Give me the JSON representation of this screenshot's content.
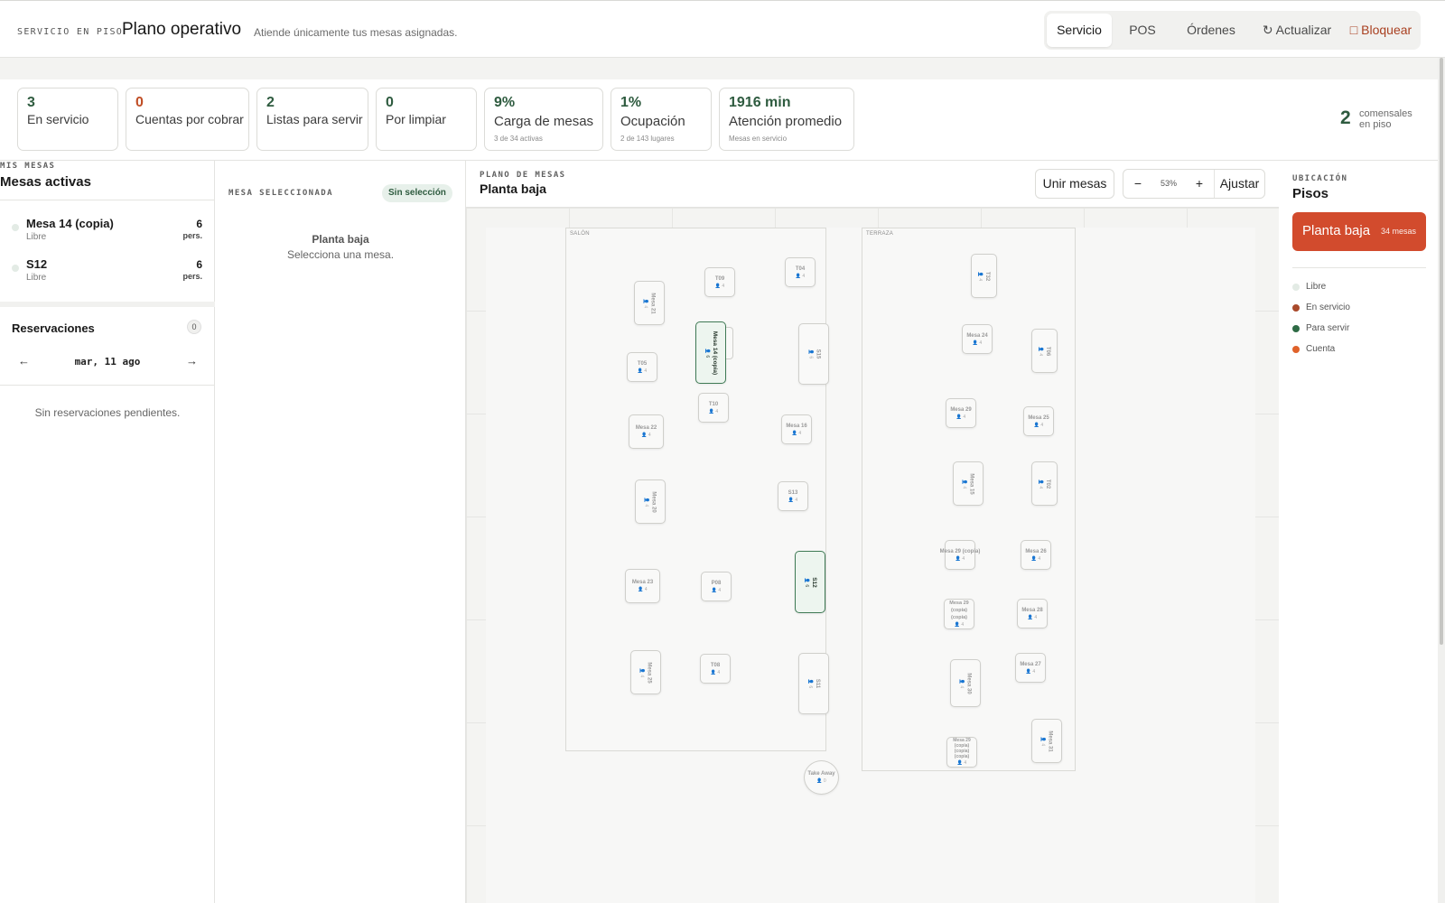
{
  "header": {
    "eyebrow": "SERVICIO EN PISO",
    "title": "Plano operativo",
    "subtitle": "Atiende únicamente tus mesas asignadas.",
    "nav": {
      "servicio": "Servicio",
      "pos": "POS",
      "ordenes": "Órdenes",
      "actualizar": "↻ Actualizar",
      "bloquear": "□ Bloquear"
    }
  },
  "stats": {
    "en_servicio": {
      "value": "3",
      "label": "En servicio"
    },
    "cuentas": {
      "value": "0",
      "label": "Cuentas por cobrar"
    },
    "listas": {
      "value": "2",
      "label": "Listas para servir"
    },
    "limpiar": {
      "value": "0",
      "label": "Por limpiar"
    },
    "carga": {
      "value": "9%",
      "label": "Carga de mesas",
      "note": "3 de 34 activas"
    },
    "ocupacion": {
      "value": "1%",
      "label": "Ocupación",
      "note": "2 de 143 lugares"
    },
    "atencion": {
      "value": "1916 min",
      "label": "Atención promedio",
      "note": "Mesas en servicio"
    },
    "comensales": {
      "value": "2",
      "label": "comensales en piso"
    }
  },
  "mis_mesas": {
    "eyebrow": "MIS MESAS",
    "title": "Mesas activas",
    "items": [
      {
        "name": "Mesa 14 (copia)",
        "status": "Libre",
        "capacity": "6",
        "unit": "pers."
      },
      {
        "name": "S12",
        "status": "Libre",
        "capacity": "6",
        "unit": "pers."
      }
    ]
  },
  "reservaciones": {
    "title": "Reservaciones",
    "count": "0",
    "prev": "←",
    "next": "→",
    "date": "mar, 11 ago",
    "empty": "Sin reservaciones pendientes."
  },
  "seleccion": {
    "eyebrow": "MESA SELECCIONADA",
    "badge": "Sin selección",
    "floor": "Planta baja",
    "message": "Selecciona una mesa."
  },
  "plano": {
    "eyebrow": "PLANO DE MESAS",
    "title": "Planta baja",
    "unir": "Unir mesas",
    "zoom_out": "−",
    "zoom_level": "53%",
    "zoom_in": "+",
    "ajustar": "Ajustar",
    "zones": {
      "salon": "SALÓN",
      "terraza": "TERRAZA"
    },
    "tables": {
      "mesa21": {
        "name": "Mesa 21",
        "cap": "4"
      },
      "t09": {
        "name": "T09",
        "cap": "4"
      },
      "t04": {
        "name": "T04",
        "cap": "4"
      },
      "t32": {
        "name": "T32",
        "cap": "4"
      },
      "mesa14": {
        "name": "Mesa 14 (copia)",
        "cap": "6"
      },
      "s15": {
        "name": "S15",
        "cap": "6"
      },
      "mesa24": {
        "name": "Mesa 24",
        "cap": "4"
      },
      "t06": {
        "name": "T06",
        "cap": "4"
      },
      "t05": {
        "name": "T05",
        "cap": "4"
      },
      "t10": {
        "name": "T10",
        "cap": "4"
      },
      "mesa22": {
        "name": "Mesa 22",
        "cap": "4"
      },
      "mesa16": {
        "name": "Mesa 16",
        "cap": "4"
      },
      "mesa29": {
        "name": "Mesa 29",
        "cap": "4"
      },
      "mesa25b": {
        "name": "Mesa 25",
        "cap": "4"
      },
      "mesa20": {
        "name": "Mesa 20",
        "cap": "4"
      },
      "s13": {
        "name": "S13",
        "cap": "4"
      },
      "mesa15": {
        "name": "Mesa 15",
        "cap": "4"
      },
      "t02": {
        "name": "T02",
        "cap": "4"
      },
      "mesa29c": {
        "name": "Mesa 29 (copia)",
        "cap": "4"
      },
      "mesa26": {
        "name": "Mesa 26",
        "cap": "4"
      },
      "mesa23": {
        "name": "Mesa 23",
        "cap": "4"
      },
      "p08": {
        "name": "P08",
        "cap": "4"
      },
      "s12": {
        "name": "S12",
        "cap": "6"
      },
      "mesa29cc": {
        "name": "Mesa 29 (copia) (copia)",
        "cap": "4"
      },
      "mesa28": {
        "name": "Mesa 28",
        "cap": "4"
      },
      "mesa25": {
        "name": "Mesa 25",
        "cap": "4"
      },
      "t08": {
        "name": "T08",
        "cap": "4"
      },
      "s11": {
        "name": "S11",
        "cap": "6"
      },
      "mesa30": {
        "name": "Mesa 30",
        "cap": "4"
      },
      "mesa27": {
        "name": "Mesa 27",
        "cap": "4"
      },
      "mesa29ccc": {
        "name": "Mesa 29 (copia) (copia) (copia)",
        "cap": "4"
      },
      "mesa31": {
        "name": "Mesa 31",
        "cap": "4"
      },
      "takeaway": {
        "name": "Take Away",
        "cap": "0"
      }
    }
  },
  "ubicacion": {
    "eyebrow": "UBICACIÓN",
    "title": "Pisos",
    "floor_name": "Planta baja",
    "floor_count": "34 mesas",
    "legend": [
      {
        "label": "Libre",
        "color": "#e3ebe5"
      },
      {
        "label": "En servicio",
        "color": "#a94a2c"
      },
      {
        "label": "Para servir",
        "color": "#2e6b45"
      },
      {
        "label": "Cuenta",
        "color": "#e0622a"
      }
    ]
  }
}
